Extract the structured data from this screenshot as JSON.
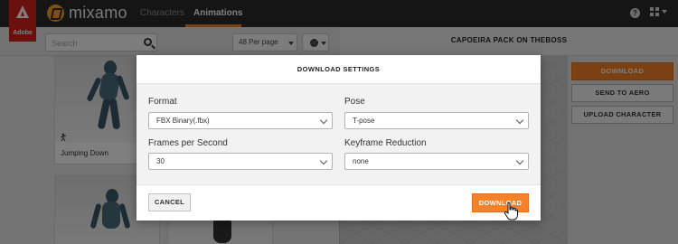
{
  "header": {
    "adobe_label": "Adobe",
    "brand": "mixamo",
    "tabs": [
      {
        "label": "Characters",
        "active": false
      },
      {
        "label": "Animations",
        "active": true
      }
    ],
    "icons": [
      "help-icon",
      "apps-grid-icon"
    ],
    "accent_color": "#f5822a"
  },
  "toolbar": {
    "search_placeholder": "Search",
    "per_page": "48 Per page"
  },
  "pack": {
    "title": "CAPOEIRA PACK ON THEBOSS"
  },
  "cards": [
    {
      "label": "Jumping Down"
    },
    {
      "label": ""
    }
  ],
  "side_panel": {
    "download": "DOWNLOAD",
    "send_to_aero": "SEND TO AERO",
    "upload_character": "UPLOAD CHARACTER"
  },
  "modal": {
    "title": "DOWNLOAD SETTINGS",
    "format": {
      "label": "Format",
      "value": "FBX Binary(.fbx)"
    },
    "pose": {
      "label": "Pose",
      "value": "T-pose"
    },
    "fps": {
      "label": "Frames per Second",
      "value": "30"
    },
    "keyframe": {
      "label": "Keyframe Reduction",
      "value": "none"
    },
    "cancel": "CANCEL",
    "download": "DOWNLOAD"
  }
}
